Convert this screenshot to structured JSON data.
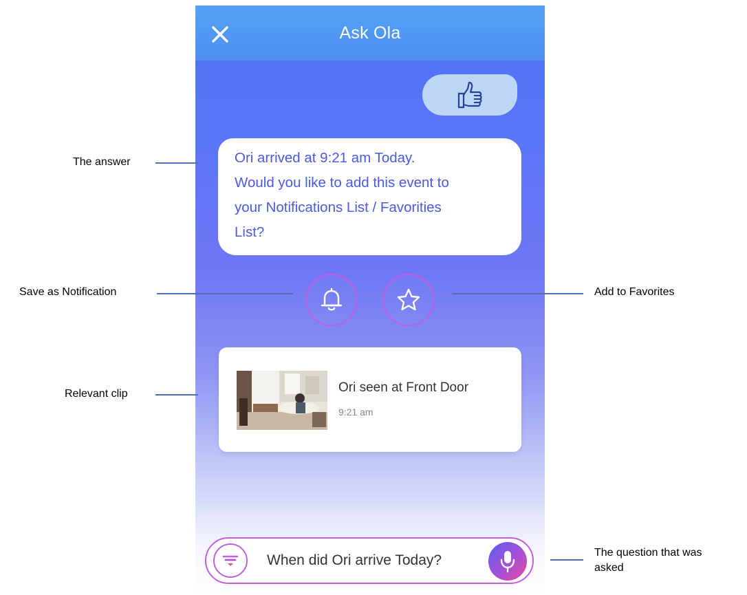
{
  "header": {
    "title": "Ask Ola",
    "close_icon": "close-icon"
  },
  "reaction": {
    "icon": "thumbs-up-icon"
  },
  "answer": {
    "lines": [
      "Ori arrived at 9:21 am Today.",
      "Would you like to add this event to",
      "your Notifications List / Favorities",
      "List?"
    ]
  },
  "actions": {
    "notification_icon": "bell-icon",
    "favorite_icon": "star-icon"
  },
  "clip": {
    "title": "Ori seen at Front Door",
    "time": "9:21 am",
    "thumbnail": "clip-thumbnail"
  },
  "ask": {
    "question": "When did Ori arrive Today?",
    "filter_icon": "filter-icon",
    "mic_icon": "microphone-icon"
  },
  "annotations": {
    "answer": "The answer",
    "save_notification": "Save as Notification",
    "add_favorites": "Add to Favorites",
    "relevant_clip": "Relevant clip",
    "question_line1": "The question that was",
    "question_line2": "asked"
  },
  "colors": {
    "header": "#4e8ff4",
    "accent": "#4a59e6",
    "border": "#c25ee0",
    "bubble_reaction": "#bcd6f6",
    "leader_line": "#4a6fb5"
  }
}
